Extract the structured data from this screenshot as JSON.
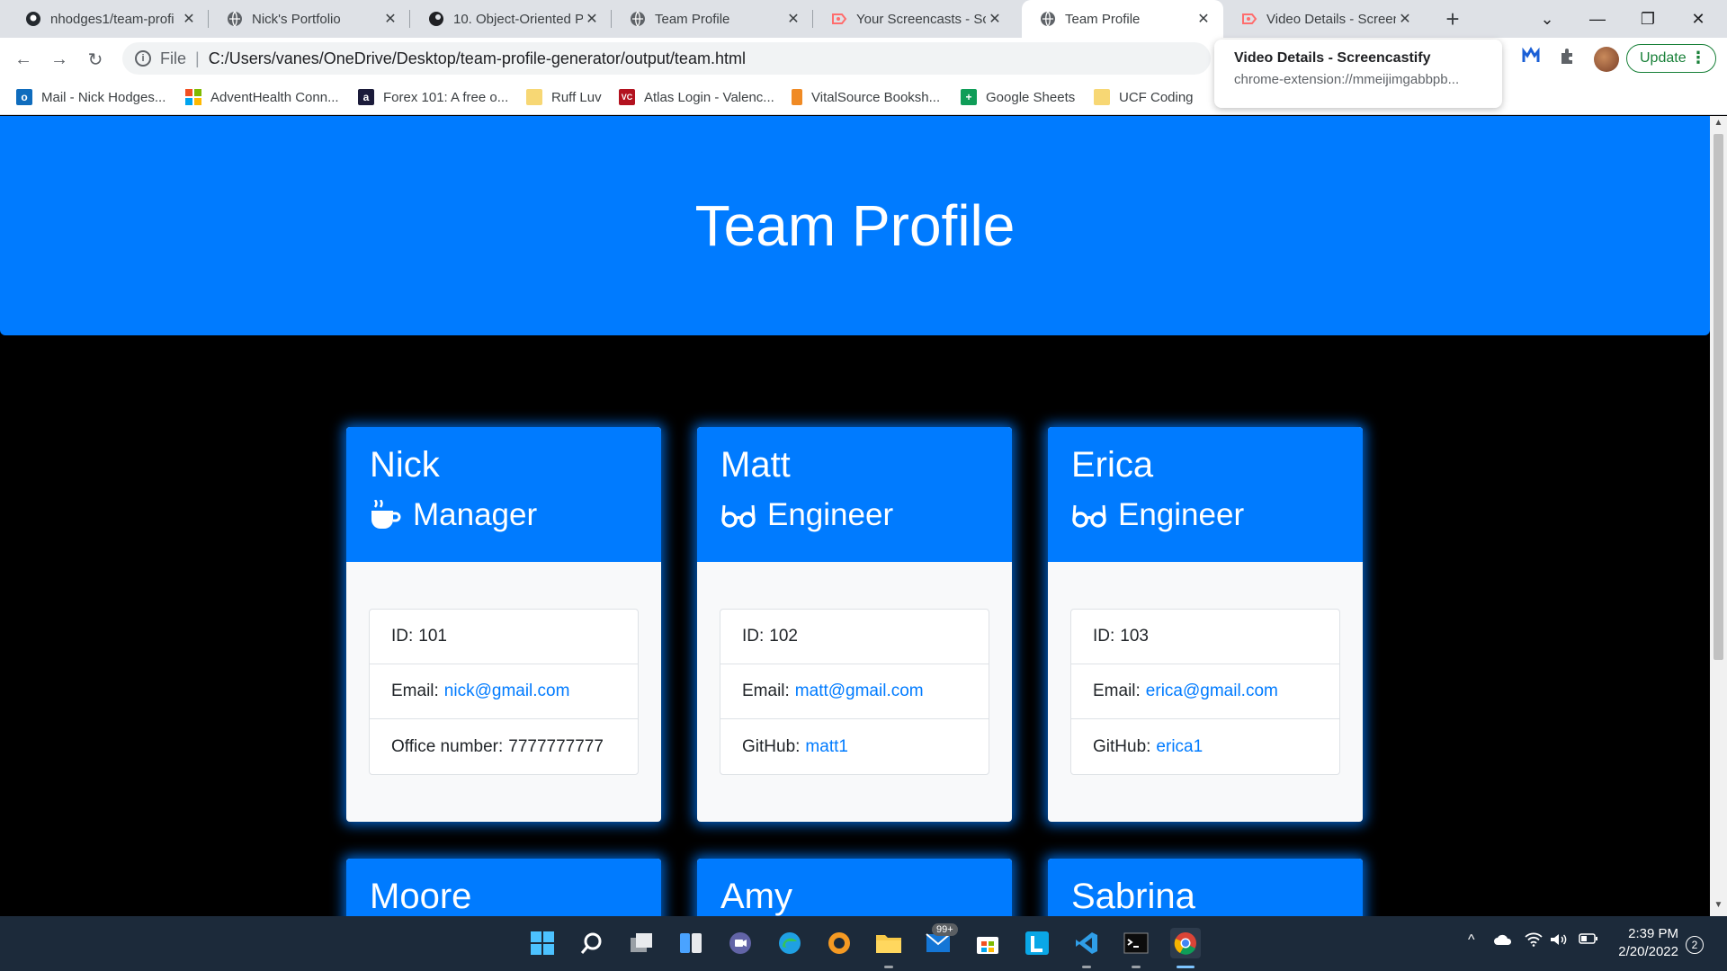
{
  "browser": {
    "tabs": [
      {
        "title": "nhodges1/team-profi",
        "icon": "github-icon"
      },
      {
        "title": "Nick's Portfolio",
        "icon": "globe-icon"
      },
      {
        "title": "10. Object-Oriented P",
        "icon": "ucf-icon"
      },
      {
        "title": "Team Profile",
        "icon": "globe-icon"
      },
      {
        "title": "Your Screencasts - Scr",
        "icon": "screencastify-icon"
      },
      {
        "title": "Team Profile",
        "icon": "globe-icon",
        "active": true
      },
      {
        "title": "Video Details - Screen",
        "icon": "screencastify-icon"
      }
    ],
    "address": {
      "scheme_label": "File",
      "url": "C:/Users/vanes/OneDrive/Desktop/team-profile-generator/output/team.html"
    },
    "update_label": "Update",
    "hovercard": {
      "title": "Video Details - Screencastify",
      "url": "chrome-extension://mmeijimgabbpb..."
    },
    "bookmarks": [
      {
        "label": "Mail - Nick Hodges...",
        "icon": "outlook-icon"
      },
      {
        "label": "AdventHealth Conn...",
        "icon": "microsoft-icon"
      },
      {
        "label": "Forex 101: A free o...",
        "icon": "forex-icon"
      },
      {
        "label": "Ruff Luv",
        "icon": "folder-icon"
      },
      {
        "label": "Atlas Login - Valenc...",
        "icon": "atlas-icon"
      },
      {
        "label": "VitalSource Booksh...",
        "icon": "vitalsource-icon"
      },
      {
        "label": "Google Sheets",
        "icon": "sheets-icon"
      },
      {
        "label": "UCF Coding",
        "icon": "folder-icon"
      }
    ]
  },
  "page": {
    "title": "Team Profile",
    "members": [
      {
        "name": "Nick",
        "role": "Manager",
        "role_icon": "mug-icon",
        "id_label": "ID:",
        "id": "101",
        "email_label": "Email:",
        "email": "nick@gmail.com",
        "extra_label": "Office number:",
        "extra": "7777777777",
        "extra_is_link": false
      },
      {
        "name": "Matt",
        "role": "Engineer",
        "role_icon": "glasses-icon",
        "id_label": "ID:",
        "id": "102",
        "email_label": "Email:",
        "email": "matt@gmail.com",
        "extra_label": "GitHub:",
        "extra": "matt1",
        "extra_is_link": true
      },
      {
        "name": "Erica",
        "role": "Engineer",
        "role_icon": "glasses-icon",
        "id_label": "ID:",
        "id": "103",
        "email_label": "Email:",
        "email": "erica@gmail.com",
        "extra_label": "GitHub:",
        "extra": "erica1",
        "extra_is_link": true
      },
      {
        "name": "Moore"
      },
      {
        "name": "Amy"
      },
      {
        "name": "Sabrina"
      }
    ]
  },
  "taskbar": {
    "mail_badge": "99+",
    "time": "2:39 PM",
    "date": "2/20/2022",
    "notifications": "2"
  },
  "colors": {
    "accent": "#007bff",
    "page_background": "#000000"
  }
}
